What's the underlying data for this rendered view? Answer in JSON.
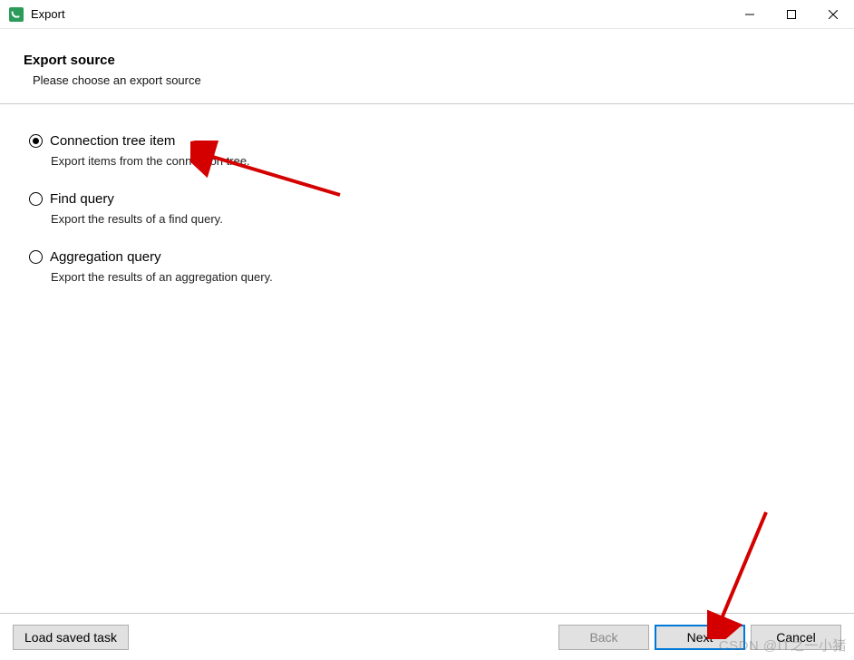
{
  "window": {
    "title": "Export"
  },
  "header": {
    "title": "Export source",
    "subtitle": "Please choose an export source"
  },
  "options": [
    {
      "label": "Connection tree item",
      "description": "Export items from the connection tree.",
      "selected": true
    },
    {
      "label": "Find query",
      "description": "Export the results of a find query.",
      "selected": false
    },
    {
      "label": "Aggregation query",
      "description": "Export the results of an aggregation query.",
      "selected": false
    }
  ],
  "footer": {
    "load_saved_task": "Load saved task",
    "back": "Back",
    "next": "Next",
    "cancel": "Cancel"
  },
  "watermark": "CSDN @IT之一小猪"
}
